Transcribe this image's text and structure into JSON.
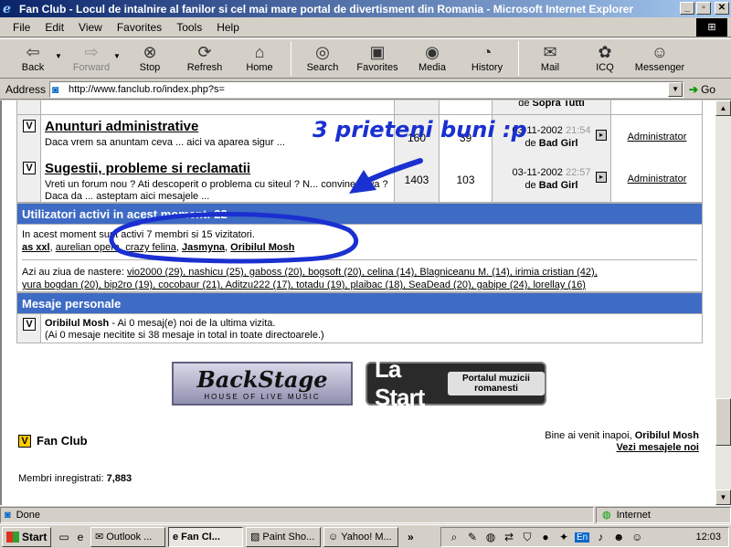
{
  "window": {
    "title": "Fan Club - Locul de intalnire al fanilor si cel mai mare portal de divertisment din Romania - Microsoft Internet Explorer",
    "btn_min": "_",
    "btn_max": "▫",
    "btn_close": "✕"
  },
  "menu": [
    "File",
    "Edit",
    "View",
    "Favorites",
    "Tools",
    "Help"
  ],
  "toolbar": {
    "back": "Back",
    "forward": "Forward",
    "stop": "Stop",
    "refresh": "Refresh",
    "home": "Home",
    "search": "Search",
    "favorites": "Favorites",
    "media": "Media",
    "history": "History",
    "mail": "Mail",
    "icq": "ICQ",
    "messenger": "Messenger"
  },
  "address": {
    "label": "Address",
    "url": "http://www.fanclub.ro/index.php?s=",
    "go": "Go"
  },
  "forums": [
    {
      "title": "",
      "desc": "",
      "posts": "",
      "topics": "",
      "last_date": "",
      "last_time": "",
      "last_by": "de",
      "last_user": "Sopra Tutti",
      "moderator": ""
    },
    {
      "title": "Anunturi administrative",
      "desc": "Daca vrem sa anuntam ceva ... aici va aparea sigur ...",
      "posts": "160",
      "topics": "39",
      "last_date": "03-11-2002",
      "last_time": "21:54",
      "last_by": "de",
      "last_user": "Bad Girl",
      "moderator": "Administrator"
    },
    {
      "title": "Sugestii, probleme si reclamatii",
      "desc": "Vreti un forum nou ? Ati descoperit o problema cu siteul ? N... convine ceva ? Daca da ... asteptam aici mesajele ...",
      "posts": "1403",
      "topics": "103",
      "last_date": "03-11-2002",
      "last_time": "22:57",
      "last_by": "de",
      "last_user": "Bad Girl",
      "moderator": "Administrator"
    }
  ],
  "active_users": {
    "header": "Utilizatori activi in acest moment: 22",
    "summary": "In acest moment sunt activi 7 membri si 15 vizitatori.",
    "users": [
      "as xxl",
      "aurelian opera",
      "crazy felina",
      "Jasmyna",
      "Oribilul Mosh"
    ],
    "birthday_prefix": "Azi au ziua de nastere:",
    "birthday_line1": "vio2000 (29), nashicu (25), gaboss (20), bogsoft (20), celina (14), Blagniceanu M. (14), irimia cristian (42),",
    "birthday_line2": "yura bogdan (20), bip2ro (19), cocobaur (21), Aditzu222 (17), totadu (19), plaibac (18), SeaDead (20), gabipe (24), lorellay (16)"
  },
  "pm": {
    "header": "Mesaje personale",
    "user": "Oribilul Mosh",
    "line1": " - Ai 0 mesaj(e) noi de la ultima vizita.",
    "line2": "(Ai 0 mesaje necitite si 38 mesaje in total in toate directoarele.)"
  },
  "banners": {
    "backstage_big": "BackStage",
    "backstage_small": "HOUSE OF LIVE MUSIC",
    "lastart_big": "La Start",
    "lastart_small": "Portalul muzicii romanesti"
  },
  "footer": {
    "logo": "Fan Club",
    "welcome_prefix": "Bine ai venit inapoi, ",
    "welcome_user": "Oribilul Mosh",
    "view_msgs": "Vezi mesajele noi",
    "members_label": "Membri inregistrati:",
    "members_count": "7,883"
  },
  "annotation": {
    "text": "3 prieteni buni :p"
  },
  "status": {
    "text": "Done",
    "zone": "Internet"
  },
  "taskbar": {
    "start": "Start",
    "tasks": [
      "Outlook ...",
      "Fan Cl...",
      "Paint Sho...",
      "Yahoo! M..."
    ],
    "chevron": "»",
    "lang": "En",
    "clock": "12:03"
  },
  "colors": {
    "header_blue": "#3e6bc4",
    "annotation_blue": "#1a30d0"
  }
}
